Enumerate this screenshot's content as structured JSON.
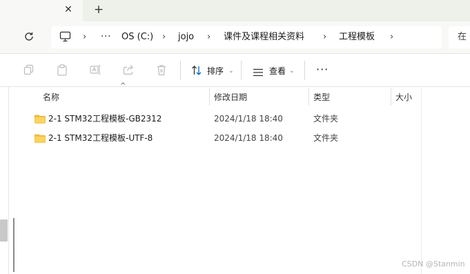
{
  "tabs": {
    "close_glyph": "✕",
    "new_tab_glyph": "+"
  },
  "address": {
    "overflow": "···",
    "crumbs": [
      "OS (C:)",
      "jojo",
      "课件及课程相关资料",
      "工程模板"
    ],
    "chevron": "›",
    "search_text": "在"
  },
  "commands": {
    "sort_label": "排序",
    "view_label": "查看",
    "more": "···",
    "dropdown": "⌄"
  },
  "columns": {
    "name": "名称",
    "modified": "修改日期",
    "type": "类型",
    "size": "大小"
  },
  "files": [
    {
      "name": "2-1 STM32工程模板-GB2312",
      "modified": "2024/1/18 18:40",
      "type": "文件夹"
    },
    {
      "name": "2-1 STM32工程模板-UTF-8",
      "modified": "2024/1/18 18:40",
      "type": "文件夹"
    }
  ],
  "watermark": "CSDN @Stanmin",
  "colors": {
    "folder": "#f5c242",
    "accent": "#0067c0"
  }
}
